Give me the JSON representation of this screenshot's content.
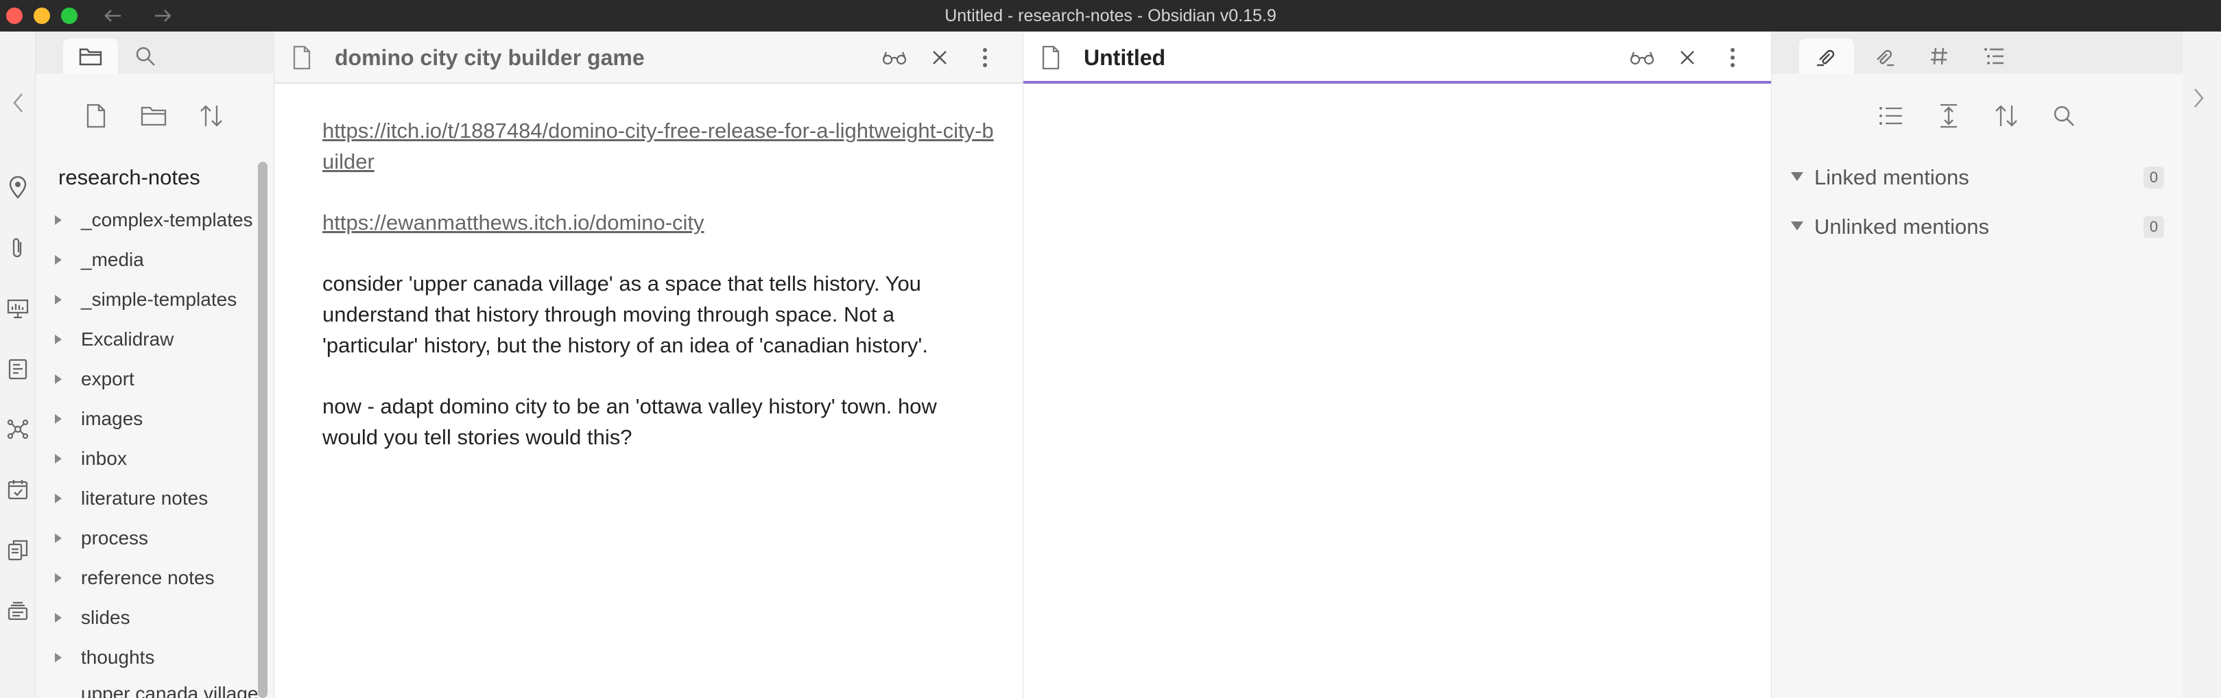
{
  "window": {
    "title": "Untitled - research-notes - Obsidian v0.15.9"
  },
  "ribbon": {
    "icons": [
      "map-pin-icon",
      "paperclip-icon",
      "slides-icon",
      "template-icon",
      "graph-icon",
      "calendar-icon",
      "copy-icon",
      "stack-icon"
    ]
  },
  "left_panel": {
    "tabs": [
      "folder-icon",
      "search-icon"
    ],
    "vault_name": "research-notes",
    "folders": [
      {
        "label": "_complex-templates"
      },
      {
        "label": "_media"
      },
      {
        "label": "_simple-templates"
      },
      {
        "label": "Excalidraw"
      },
      {
        "label": "export"
      },
      {
        "label": "images"
      },
      {
        "label": "inbox"
      },
      {
        "label": "literature notes"
      },
      {
        "label": "process"
      },
      {
        "label": "reference notes"
      },
      {
        "label": "slides"
      },
      {
        "label": "thoughts"
      }
    ],
    "partial_file": "upper canada village"
  },
  "panes": [
    {
      "title": "domino city city builder game",
      "active": false,
      "paragraphs": [
        {
          "text": "https://itch.io/t/1887484/domino-city-free-release-for-a-lightweight-city-builder",
          "link": true
        },
        {
          "text": "https://ewanmatthews.itch.io/domino-city",
          "link": true
        },
        {
          "text": "consider 'upper canada village' as a space that tells history. You understand that history through moving through space. Not a 'particular' history, but the history of an idea of 'canadian history'.",
          "link": false
        },
        {
          "text": "now - adapt domino city to be an 'ottawa valley history' town. how would you tell stories would this?",
          "link": false
        }
      ]
    },
    {
      "title": "Untitled",
      "active": true
    }
  ],
  "right_panel": {
    "tabs": [
      "backlinks-icon",
      "outgoing-links-icon",
      "tags-icon",
      "outline-icon"
    ],
    "mentions": [
      {
        "label": "Linked mentions",
        "count": "0"
      },
      {
        "label": "Unlinked mentions",
        "count": "0"
      }
    ]
  },
  "colors": {
    "accent": "#8b6fd6",
    "titlebar": "#2a2a2a"
  }
}
